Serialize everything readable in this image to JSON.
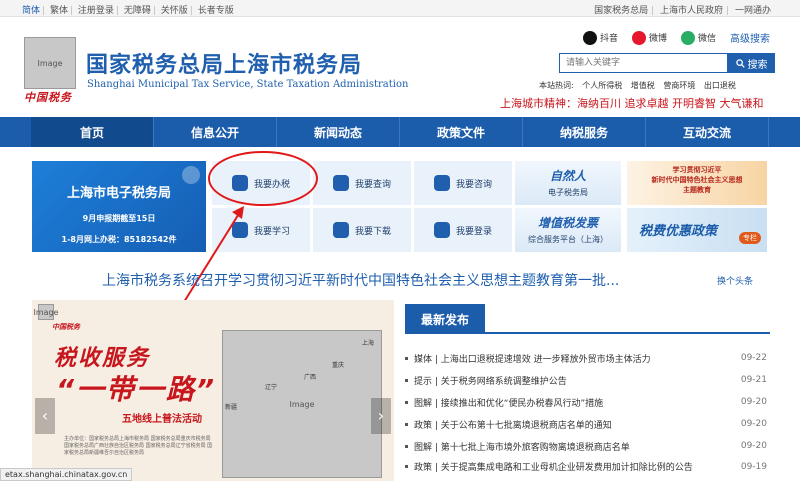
{
  "topbar": {
    "left_links": [
      "简体",
      "繁体",
      "注册登录",
      "无障碍",
      "关怀版",
      "长者专版"
    ],
    "right_links": [
      "国家税务总局",
      "上海市人民政府",
      "一网通办"
    ]
  },
  "header": {
    "logo_script": "中国税务",
    "title": "国家税务总局上海市税务局",
    "subtitle": "Shanghai Municipal Tax Service, State Taxation Administration",
    "social": [
      {
        "label": "抖音",
        "icon": "douyin-icon"
      },
      {
        "label": "微博",
        "icon": "weibo-icon"
      },
      {
        "label": "微信",
        "icon": "weixin-icon"
      }
    ],
    "advanced_search": "高级搜索",
    "search_placeholder": "请输入关键字",
    "search_button": "搜索",
    "hot_label": "本站热词:",
    "hot_words": [
      "个人所得税",
      "增值税",
      "营商环境",
      "出口退税"
    ],
    "city_spirit": "上海城市精神：海纳百川 追求卓越 开明睿智 大气谦和"
  },
  "nav": [
    "首页",
    "信息公开",
    "新闻动态",
    "政策文件",
    "纳税服务",
    "互动交流"
  ],
  "etax": {
    "title": "上海市电子税务局",
    "deadline": "9月申报期截至15日",
    "phone": "1-8月网上办税：85182542件"
  },
  "services": [
    {
      "label": "我要办税",
      "icon": "tax-handling-icon"
    },
    {
      "label": "我要查询",
      "icon": "query-icon"
    },
    {
      "label": "我要咨询",
      "icon": "consult-icon"
    },
    {
      "label": "我要学习",
      "icon": "study-icon"
    },
    {
      "label": "我要下载",
      "icon": "download-icon"
    },
    {
      "label": "我要登录",
      "icon": "login-icon"
    }
  ],
  "banners": [
    {
      "title": "自然人",
      "sub": "电子税务局"
    },
    {
      "title": "增值税发票",
      "sub": "综合服务平台（上海）"
    }
  ],
  "promos": {
    "study": "学习贯彻习近平\n新时代中国特色社会主义思想\n主题教育",
    "tax_benefit": "税费优惠政策",
    "tax_benefit_tag": "专栏"
  },
  "headline": "上海市税务系统召开学习贯彻习近平新时代中国特色社会主义思想主题教育第一批...",
  "swap_label": "换个头条",
  "slide": {
    "logo_text": "中国税务",
    "title_line1": "税收服务",
    "title_line2": "“一带一路”",
    "subtitle": "五地线上普法活动",
    "cities": [
      "上海",
      "重庆",
      "广西",
      "辽宁",
      "新疆"
    ],
    "footnote": "主办单位：国家税务总局上海市税务局 国家税务总局重庆市税务局 国家税务总局广西壮族自治区税务局 国家税务总局辽宁省税务局 国家税务总局新疆维吾尔自治区税务局"
  },
  "status_url": "etax.shanghai.chinatax.gov.cn",
  "news": {
    "tab": "最新发布",
    "items": [
      {
        "type": "媒体",
        "title": "上海出口退税提速增效 进一步释放外贸市场主体活力",
        "date": "09-22"
      },
      {
        "type": "提示",
        "title": "关于税务网络系统调整维护公告",
        "date": "09-21"
      },
      {
        "type": "图解",
        "title": "接续推出和优化“便民办税春风行动”措施",
        "date": "09-20"
      },
      {
        "type": "政策",
        "title": "关于公布第十七批离境退税商店名单的通知",
        "date": "09-20"
      },
      {
        "type": "图解",
        "title": "第十七批上海市境外旅客购物离境退税商店名单",
        "date": "09-20"
      },
      {
        "type": "政策",
        "title": "关于提高集成电路和工业母机企业研发费用加计扣除比例的公告",
        "date": "09-19"
      }
    ]
  }
}
